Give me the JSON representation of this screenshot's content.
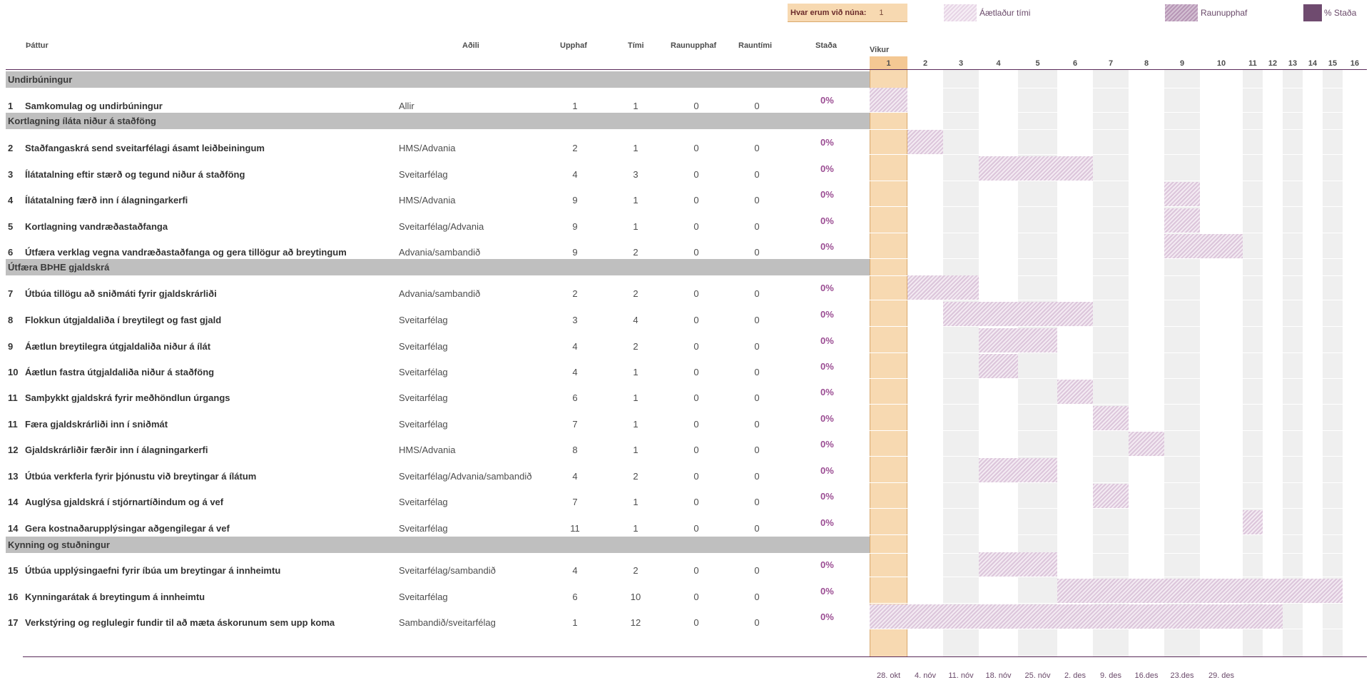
{
  "top": {
    "now_label": "Hvar erum við núna:",
    "now_value": "1",
    "legend_planned": "Áætlaður tími",
    "legend_actual": "Raunupphaf",
    "legend_status": "% Staða"
  },
  "columns": {
    "thattur": "Þáttur",
    "adili": "Aðili",
    "upphaf": "Upphaf",
    "timi": "Tími",
    "raunupphaf": "Raunupphaf",
    "rauntimi": "Rauntími",
    "stada": "Staða",
    "vikur": "Vikur"
  },
  "weeks": [
    "1",
    "2",
    "3",
    "4",
    "5",
    "6",
    "7",
    "8",
    "9",
    "10",
    "11",
    "12",
    "13",
    "14",
    "15",
    "16"
  ],
  "dates": [
    "28. okt",
    "4. nóv",
    "11. nóv",
    "18. nóv",
    "25. nóv",
    "2. des",
    "9. des",
    "16.des",
    "23.des",
    "29. des"
  ],
  "sections": [
    {
      "title": "Undirbúningur"
    },
    {
      "title": "Kortlagning íláta niður á staðföng"
    },
    {
      "title": "Útfæra BÞHE gjaldskrá"
    },
    {
      "title": "Kynning og stuðningur"
    }
  ],
  "rows": [
    {
      "nr": "1",
      "task": "Samkomulag og undirbúningur",
      "party": "Allir",
      "start": "1",
      "dur": "1",
      "rstart": "0",
      "rdur": "0",
      "pct": "0%"
    },
    {
      "nr": "2",
      "task": "Staðfangaskrá send sveitarfélagi ásamt leiðbeiningum",
      "party": "HMS/Advania",
      "start": "2",
      "dur": "1",
      "rstart": "0",
      "rdur": "0",
      "pct": "0%"
    },
    {
      "nr": "3",
      "task": "Ílátatalning eftir stærð og tegund niður á staðföng",
      "party": "Sveitarfélag",
      "start": "4",
      "dur": "3",
      "rstart": "0",
      "rdur": "0",
      "pct": "0%"
    },
    {
      "nr": "4",
      "task": "Ílátatalning færð inn í álagningarkerfi",
      "party": "HMS/Advania",
      "start": "9",
      "dur": "1",
      "rstart": "0",
      "rdur": "0",
      "pct": "0%"
    },
    {
      "nr": "5",
      "task": "Kortlagning vandræðastaðfanga",
      "party": "Sveitarfélag/Advania",
      "start": "9",
      "dur": "1",
      "rstart": "0",
      "rdur": "0",
      "pct": "0%"
    },
    {
      "nr": "6",
      "task": "Útfæra verklag vegna vandræðastaðfanga og gera tillögur að breytingum",
      "party": "Advania/sambandið",
      "start": "9",
      "dur": "2",
      "rstart": "0",
      "rdur": "0",
      "pct": "0%"
    },
    {
      "nr": "7",
      "task": "Útbúa tillögu að sniðmáti fyrir gjaldskrárliði",
      "party": "Advania/sambandið",
      "start": "2",
      "dur": "2",
      "rstart": "0",
      "rdur": "0",
      "pct": "0%"
    },
    {
      "nr": "8",
      "task": "Flokkun útgjaldaliða í breytilegt og fast gjald",
      "party": "Sveitarfélag",
      "start": "3",
      "dur": "4",
      "rstart": "0",
      "rdur": "0",
      "pct": "0%"
    },
    {
      "nr": "9",
      "task": "Áætlun breytilegra útgjaldaliða niður á ílát",
      "party": "Sveitarfélag",
      "start": "4",
      "dur": "2",
      "rstart": "0",
      "rdur": "0",
      "pct": "0%"
    },
    {
      "nr": "10",
      "task": "Áætlun fastra útgjaldaliða niður á staðföng",
      "party": "Sveitarfélag",
      "start": "4",
      "dur": "1",
      "rstart": "0",
      "rdur": "0",
      "pct": "0%"
    },
    {
      "nr": "11",
      "task": "Samþykkt gjaldskrá fyrir meðhöndlun úrgangs",
      "party": "Sveitarfélag",
      "start": "6",
      "dur": "1",
      "rstart": "0",
      "rdur": "0",
      "pct": "0%"
    },
    {
      "nr": "11",
      "task": "Færa gjaldskrárliði inn í sniðmát",
      "party": "Sveitarfélag",
      "start": "7",
      "dur": "1",
      "rstart": "0",
      "rdur": "0",
      "pct": "0%"
    },
    {
      "nr": "12",
      "task": "Gjaldskrárliðir færðir inn í álagningarkerfi",
      "party": "HMS/Advania",
      "start": "8",
      "dur": "1",
      "rstart": "0",
      "rdur": "0",
      "pct": "0%"
    },
    {
      "nr": "13",
      "task": "Útbúa verkferla fyrir þjónustu við breytingar á ílátum",
      "party": "Sveitarfélag/Advania/sambandið",
      "start": "4",
      "dur": "2",
      "rstart": "0",
      "rdur": "0",
      "pct": "0%"
    },
    {
      "nr": "14",
      "task": "Auglýsa gjaldskrá í stjórnartíðindum og á vef",
      "party": "Sveitarfélag",
      "start": "7",
      "dur": "1",
      "rstart": "0",
      "rdur": "0",
      "pct": "0%"
    },
    {
      "nr": "14",
      "task": "Gera kostnaðarupplýsingar aðgengilegar á vef",
      "party": "Sveitarfélag",
      "start": "11",
      "dur": "1",
      "rstart": "0",
      "rdur": "0",
      "pct": "0%"
    },
    {
      "nr": "15",
      "task": "Útbúa upplýsingaefni fyrir íbúa um breytingar á innheimtu",
      "party": "Sveitarfélag/sambandið",
      "start": "4",
      "dur": "2",
      "rstart": "0",
      "rdur": "0",
      "pct": "0%"
    },
    {
      "nr": "16",
      "task": "Kynningarátak á breytingum á innheimtu",
      "party": "Sveitarfélag",
      "start": "6",
      "dur": "10",
      "rstart": "0",
      "rdur": "0",
      "pct": "0%"
    },
    {
      "nr": "17",
      "task": "Verkstýring og reglulegir fundir til að mæta áskorunum sem upp koma",
      "party": "Sambandið/sveitarfélag",
      "start": "1",
      "dur": "12",
      "rstart": "0",
      "rdur": "0",
      "pct": "0%"
    }
  ],
  "colors": {
    "accent": "#f7d9b1",
    "section_bg": "#bfbfbf",
    "status_text": "#9b4d93",
    "planned_bar": "#dcc6db",
    "status_swatch": "#6f4b6f"
  }
}
